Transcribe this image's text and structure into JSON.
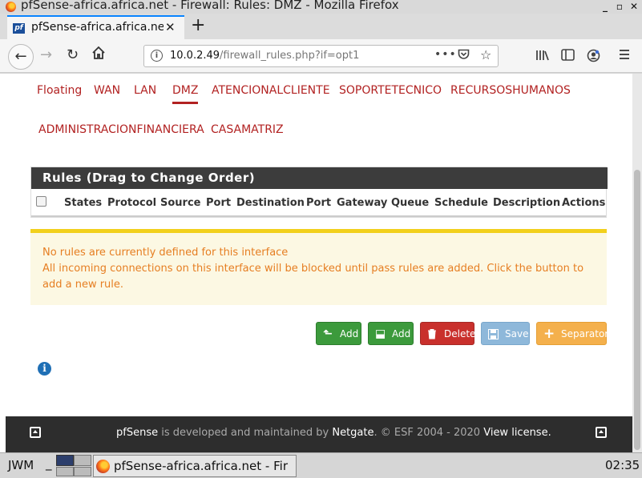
{
  "window": {
    "title": "pfSense-africa.africa.net - Firewall: Rules: DMZ - Mozilla Firefox",
    "minimize": "_",
    "maximize": "▫",
    "close": "✕"
  },
  "browser": {
    "tab_title": "pfSense-africa.africa.net - ",
    "tab_favicon": "pf",
    "tab_close": "✕",
    "new_tab": "+",
    "url_host": "10.0.2.49",
    "url_path": "/firewall_rules.php?if=opt1",
    "page_actions": "•••"
  },
  "interface_tabs": [
    {
      "label": "Floating"
    },
    {
      "label": "WAN"
    },
    {
      "label": "LAN"
    },
    {
      "label": "DMZ",
      "active": true
    },
    {
      "label": "ATENCIONALCLIENTE"
    },
    {
      "label": "SOPORTETECNICO"
    },
    {
      "label": "RECURSOSHUMANOS"
    },
    {
      "label": "ADMINISTRACIONFINANCIERA"
    },
    {
      "label": "CASAMATRIZ"
    }
  ],
  "rules_panel": {
    "title": "Rules (Drag to Change Order)",
    "columns": [
      "States",
      "Protocol",
      "Source",
      "Port",
      "Destination",
      "Port",
      "Gateway",
      "Queue",
      "Schedule",
      "Description",
      "Actions"
    ]
  },
  "alert": {
    "line1": "No rules are currently defined for this interface",
    "line2": "All incoming connections on this interface will be blocked until pass rules are added. Click the button to add a new rule."
  },
  "buttons": {
    "add_top": "Add",
    "add_bottom": "Add",
    "delete": "Delete",
    "save": "Save",
    "separator": "Separator"
  },
  "footer": {
    "brand": "pfSense",
    "text1": " is developed and maintained by ",
    "company": "Netgate",
    "text2": ". © ESF 2004 - 2020 ",
    "license": "View license."
  },
  "taskbar": {
    "wm": "JWM",
    "minimize_marker": "_",
    "task": "pfSense-africa.africa.net - Fir",
    "clock": "02:35"
  },
  "colors": {
    "accent_red": "#b22222",
    "panel_head": "#3c3c3c",
    "alert_text": "#e67e22",
    "alert_border": "#f2d01c",
    "btn_green": "#3c9a3c",
    "btn_red": "#c9302c",
    "btn_blue": "#8eb8da",
    "btn_orange": "#f4b04c"
  }
}
